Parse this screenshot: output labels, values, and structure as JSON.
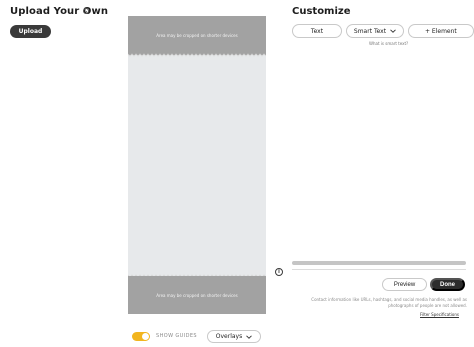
{
  "upload": {
    "title": "Upload Your Own",
    "button_label": "Upload"
  },
  "preview": {
    "crop_top_text": "Area may be cropped on shorter devices",
    "crop_bottom_text": "Area may be cropped on shorter devices"
  },
  "controls": {
    "show_guides_label": "SHOW GUIDES",
    "show_guides_on": true,
    "overlays_label": "Overlays"
  },
  "customize": {
    "title": "Customize",
    "text_button": "Text",
    "smart_text_button": "Smart Text",
    "element_button": "+ Element",
    "smart_text_help": "What is smart text?",
    "preview_button": "Preview",
    "done_button": "Done",
    "disclaimer": "Contact information like URLs, hashtags, and social media handles, as well as photographs of people are not allowed.",
    "filter_link": "Filter Specifications"
  },
  "colors": {
    "toggle_on": "#f2b51f",
    "dark_button": "#2c2c2c",
    "crop_zone": "#a2a2a2",
    "canvas": "#e7e9eb"
  },
  "icons": {
    "upload_info": "info-icon",
    "side_info": "info-icon",
    "chevron": "chevron-down-icon"
  }
}
